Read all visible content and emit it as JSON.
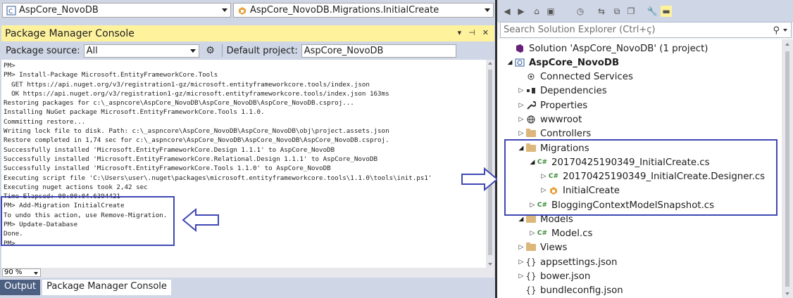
{
  "top": {
    "project_combo": "AspCore_NovoDB",
    "member_combo": "AspCore_NovoDB.Migrations.InitialCreate"
  },
  "pmc": {
    "title": "Package Manager Console",
    "source_label": "Package source:",
    "source_value": "All",
    "project_label": "Default project:",
    "project_value": "AspCore_NovoDB",
    "zoom": "90 %",
    "lines": [
      "PM>",
      "PM> Install-Package Microsoft.EntityFrameworkCore.Tools",
      "  GET https://api.nuget.org/v3/registration1-gz/microsoft.entityframeworkcore.tools/index.json",
      "  OK https://api.nuget.org/v3/registration1-gz/microsoft.entityframeworkcore.tools/index.json 163ms",
      "Restoring packages for c:\\_aspncore\\AspCore_NovoDB\\AspCore_NovoDB\\AspCore_NovoDB.csproj...",
      "Installing NuGet package Microsoft.EntityFrameworkCore.Tools 1.1.0.",
      "Committing restore...",
      "Writing lock file to disk. Path: c:\\_aspncore\\AspCore_NovoDB\\AspCore_NovoDB\\obj\\project.assets.json",
      "Restore completed in 1,74 sec for c:\\_aspncore\\AspCore_NovoDB\\AspCore_NovoDB\\AspCore_NovoDB.csproj.",
      "Successfully installed 'Microsoft.EntityFrameworkCore.Design 1.1.1' to AspCore_NovoDB",
      "Successfully installed 'Microsoft.EntityFrameworkCore.Relational.Design 1.1.1' to AspCore_NovoDB",
      "Successfully installed 'Microsoft.EntityFrameworkCore.Tools 1.1.0' to AspCore_NovoDB",
      "Executing script file 'C:\\Users\\user\\.nuget\\packages\\microsoft.entityframeworkcore.tools\\1.1.0\\tools\\init.ps1'",
      "Executing nuget actions took 2,42 sec",
      "Time Elapsed: 00:00:04.6394421",
      "PM> Add-Migration InitialCreate",
      "To undo this action, use Remove-Migration.",
      "PM> Update-Database",
      "Done.",
      "PM>"
    ]
  },
  "tabs": {
    "output": "Output",
    "pmc": "Package Manager Console"
  },
  "solution_explorer": {
    "search_placeholder": "Search Solution Explorer (Ctrl+ç)",
    "items": [
      {
        "label": "Solution 'AspCore_NovoDB' (1 project)"
      },
      {
        "label": "AspCore_NovoDB"
      },
      {
        "label": "Connected Services"
      },
      {
        "label": "Dependencies"
      },
      {
        "label": "Properties"
      },
      {
        "label": "wwwroot"
      },
      {
        "label": "Controllers"
      },
      {
        "label": "Migrations"
      },
      {
        "label": "20170425190349_InitialCreate.cs"
      },
      {
        "label": "20170425190349_InitialCreate.Designer.cs"
      },
      {
        "label": "InitialCreate"
      },
      {
        "label": "BloggingContextModelSnapshot.cs"
      },
      {
        "label": "Models"
      },
      {
        "label": "Model.cs"
      },
      {
        "label": "Views"
      },
      {
        "label": "appsettings.json"
      },
      {
        "label": "bower.json"
      },
      {
        "label": "bundleconfig.json"
      }
    ]
  },
  "colors": {
    "highlight_box": "#3f48b4",
    "title_bar": "#fff29d",
    "chrome": "#cfd6e5"
  }
}
